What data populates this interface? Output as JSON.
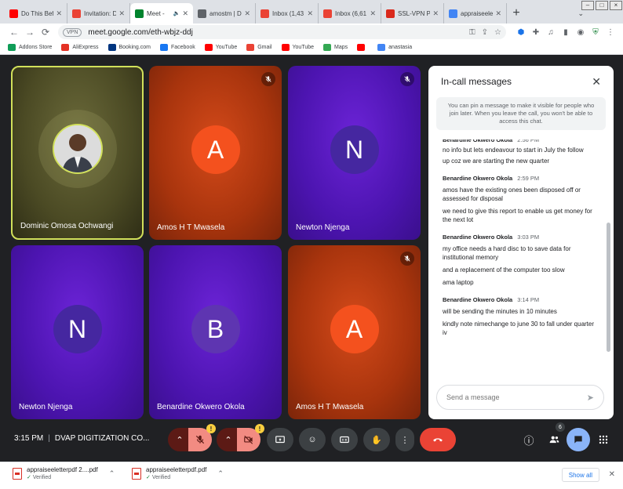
{
  "browser": {
    "tabs": [
      {
        "title": "Do This Befo",
        "icon": "youtube-icon",
        "color": "#ff0000"
      },
      {
        "title": "Invitation: D",
        "icon": "gmail-icon",
        "color": "#ea4335"
      },
      {
        "title": "Meet - ",
        "icon": "meet-icon",
        "color": "#00832d",
        "active": true
      },
      {
        "title": "amostm | D",
        "icon": "profile-icon",
        "color": "#5f6368"
      },
      {
        "title": "Inbox (1,43",
        "icon": "gmail-icon",
        "color": "#ea4335"
      },
      {
        "title": "Inbox (6,61",
        "icon": "gmail-icon",
        "color": "#ea4335"
      },
      {
        "title": "SSL-VPN Po",
        "icon": "fortinet-icon",
        "color": "#da291c"
      },
      {
        "title": "appraiseelet",
        "icon": "google-apps-icon",
        "color": "#4285f4"
      }
    ],
    "new_tab_label": "+",
    "vpn_label": "VPN",
    "url": "meet.google.com/eth-wbjz-ddj",
    "bookmarks": [
      {
        "label": "Addons Store",
        "color": "#0f9d58"
      },
      {
        "label": "AliExpress",
        "color": "#e43225"
      },
      {
        "label": "Booking.com",
        "color": "#003580"
      },
      {
        "label": "Facebook",
        "color": "#1877f2"
      },
      {
        "label": "YouTube",
        "color": "#ff0000"
      },
      {
        "label": "Gmail",
        "color": "#ea4335"
      },
      {
        "label": "YouTube",
        "color": "#ff0000"
      },
      {
        "label": "Maps",
        "color": "#34a853"
      },
      {
        "label": "",
        "color": "#ff0000"
      },
      {
        "label": "anastasia",
        "color": "#4285f4"
      }
    ]
  },
  "participants": [
    {
      "name": "Dominic Omosa Ochwangi",
      "initial": "",
      "bg": "green",
      "photo": true,
      "muted": false
    },
    {
      "name": "Amos H T Mwasela",
      "initial": "A",
      "bg": "orange",
      "avatar_color": "#f4511e",
      "muted": true
    },
    {
      "name": "Newton Njenga",
      "initial": "N",
      "bg": "purple",
      "avatar_color": "#4527a0",
      "muted": true
    },
    {
      "name": "Newton Njenga",
      "initial": "N",
      "bg": "purple",
      "avatar_color": "#4527a0",
      "muted": false
    },
    {
      "name": "Benardine Okwero Okola",
      "initial": "B",
      "bg": "purple",
      "avatar_color": "#5e35b1",
      "muted": false
    },
    {
      "name": "Amos H T Mwasela",
      "initial": "A",
      "bg": "orange",
      "avatar_color": "#f4511e",
      "muted": true
    }
  ],
  "chat": {
    "title": "In-call messages",
    "info": "You can pin a message to make it visible for people who join later. When you leave the call, you won't be able to access this chat.",
    "partial_sender": "Benardine Okwero Okola",
    "partial_time": "2:56 PM",
    "partial_messages": [
      "no info but lets endeavour to start in July the follow",
      "up coz we are starting the new quarter"
    ],
    "groups": [
      {
        "sender": "Benardine Okwero Okola",
        "time": "2:59 PM",
        "messages": [
          "amos have the existing ones been disposed off or assessed for disposal",
          "we need to give this report to enable us get money for the next lot"
        ]
      },
      {
        "sender": "Benardine Okwero Okola",
        "time": "3:03 PM",
        "messages": [
          "my office needs a hard disc to to save data for institutional memory",
          "and a replacement of the computer too slow",
          "ama laptop"
        ]
      },
      {
        "sender": "Benardine Okwero Okola",
        "time": "3:14 PM",
        "messages": [
          "will be sending the minutes in 10 minutes",
          "kindly note nimechange to june 30 to fall under quarter iv"
        ]
      }
    ],
    "input_placeholder": "Send a message"
  },
  "controls": {
    "time": "3:15 PM",
    "separator": "|",
    "meeting_name": "DVAP DIGITIZATION CO...",
    "warning_mark": "!",
    "participant_count": "6"
  },
  "downloads": {
    "items": [
      {
        "name": "appraiseeletterpdf 2....pdf",
        "status": "Verified"
      },
      {
        "name": "appraiseeletterpdf.pdf",
        "status": "Verified"
      }
    ],
    "show_all_label": "Show all"
  }
}
